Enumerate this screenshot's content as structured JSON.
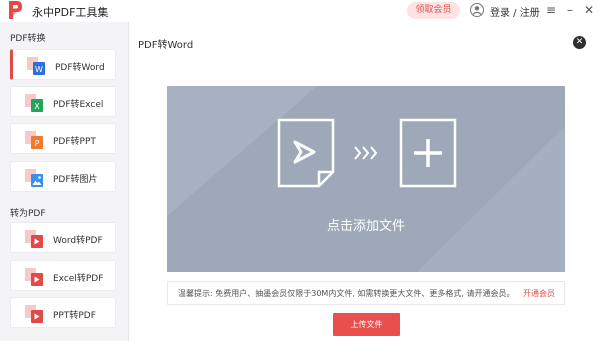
{
  "app": {
    "title": "永中PDF工具集"
  },
  "header": {
    "vip_button": "领取会员",
    "login": "登录 / 注册",
    "menu_icon": "≡",
    "minimize_icon": "–",
    "close_icon": "✕"
  },
  "sidebar": {
    "section1": "PDF转换",
    "section1_items": [
      {
        "label": "PDF转Word",
        "icon": "word-icon",
        "color": "#2b6fe0",
        "active": true
      },
      {
        "label": "PDF转Excel",
        "icon": "excel-icon",
        "color": "#22a45d",
        "active": false
      },
      {
        "label": "PDF转PPT",
        "icon": "ppt-icon",
        "color": "#f07a2e",
        "active": false
      },
      {
        "label": "PDF转图片",
        "icon": "image-icon",
        "color": "#3b8fe8",
        "active": false
      }
    ],
    "section2": "转为PDF",
    "section2_items": [
      {
        "label": "Word转PDF",
        "icon": "pdf-icon",
        "color": "#e24a48"
      },
      {
        "label": "Excel转PDF",
        "icon": "pdf-icon",
        "color": "#e24a48"
      },
      {
        "label": "PPT转PDF",
        "icon": "pdf-icon",
        "color": "#e24a48"
      }
    ]
  },
  "content": {
    "title": "PDF转Word",
    "close_icon": "✕",
    "drop_zone_text": "点击添加文件",
    "tip": "温馨提示: 免费用户、抽墨会员仅限于30M内文件, 如需转换更大文件、更多格式, 请开通会员。",
    "tip_link": "开通会员",
    "upload_button": "上传文件"
  },
  "colors": {
    "accent": "#e9504d",
    "drop_zone": "#9ea8b9",
    "sidebar_bg": "#f4f4f6"
  }
}
